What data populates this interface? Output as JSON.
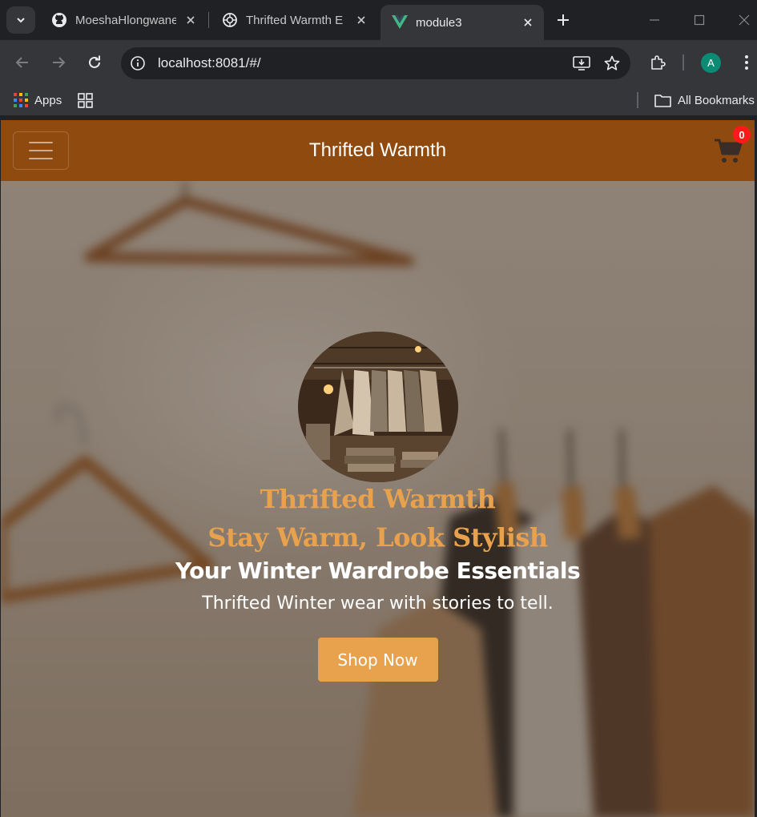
{
  "browser": {
    "tabs": [
      {
        "title": "MoeshaHlongwane",
        "icon": "github-icon"
      },
      {
        "title": "Thrifted Warmth E",
        "icon": "chatgpt-icon"
      },
      {
        "title": "module3",
        "icon": "vue-icon",
        "active": true
      }
    ],
    "url": "localhost:8081/#/",
    "profile_initial": "A",
    "bookmarks": {
      "apps_label": "Apps",
      "all_bookmarks_label": "All Bookmarks"
    }
  },
  "page": {
    "navbar": {
      "brand": "Thrifted Warmth",
      "cart_count": "0",
      "color": "#8f4b0f"
    },
    "hero": {
      "title": "Thrifted Warmth",
      "subtitle": "Stay Warm, Look Stylish",
      "heading": "Your Winter Wardrobe Essentials",
      "tagline": "Thrifted Winter wear with stories to tell.",
      "cta_label": "Shop Now",
      "accent": "#e8a14c"
    }
  }
}
